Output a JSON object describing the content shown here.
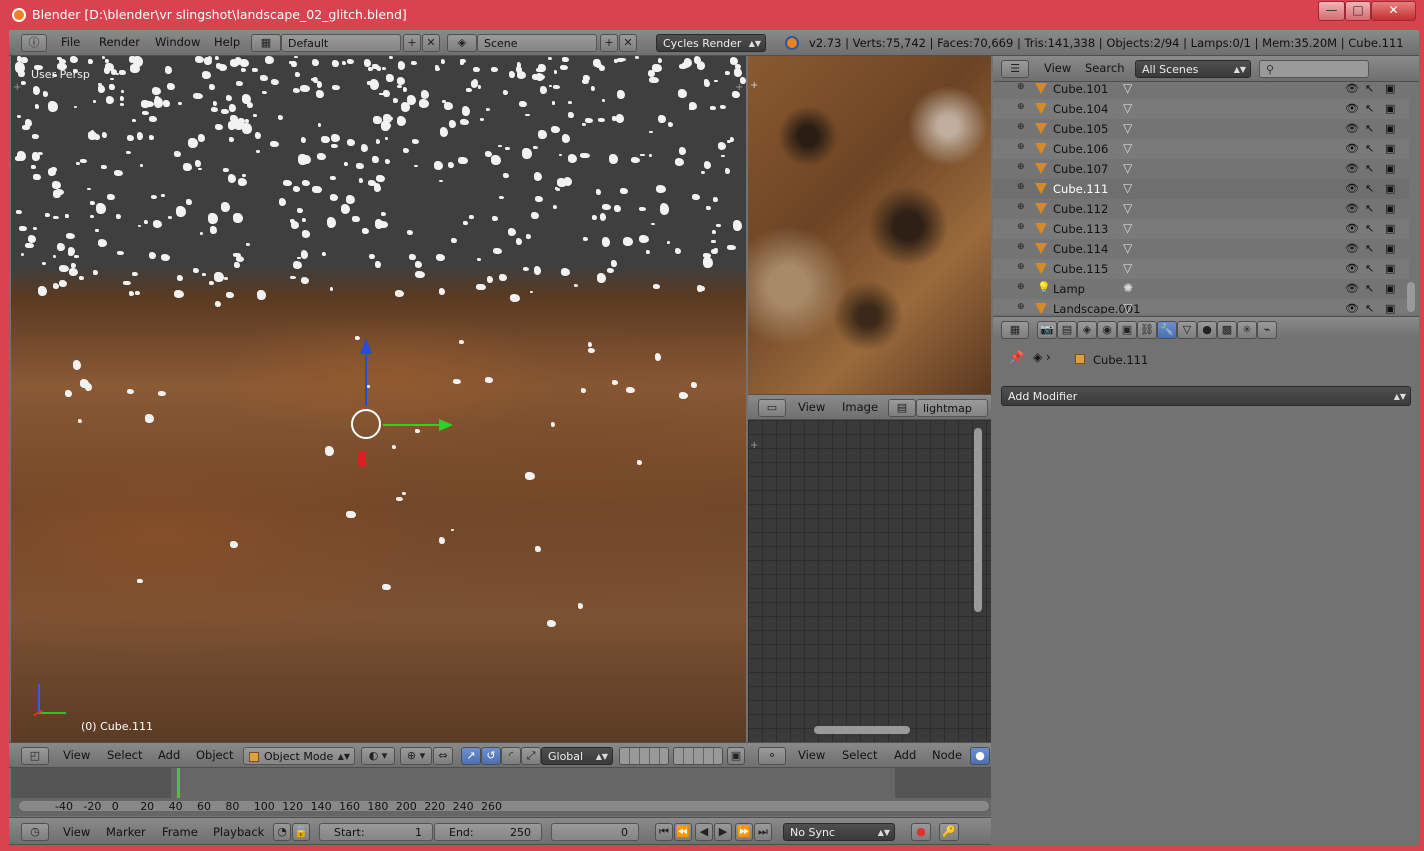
{
  "window": {
    "title": "Blender  [D:\\blender\\vr slingshot\\landscape_02_glitch.blend]",
    "minimize": "—",
    "maximize": "□",
    "close": "✕"
  },
  "topbar": {
    "menus": [
      "File",
      "Render",
      "Window",
      "Help"
    ],
    "layout": "Default",
    "scene": "Scene",
    "engine": "Cycles Render",
    "stats": "v2.73 | Verts:75,742 | Faces:70,669 | Tris:141,338 | Objects:2/94 | Lamps:0/1 | Mem:35.20M | Cube.111"
  },
  "viewport": {
    "view_label": "User Persp",
    "object_label": "(0) Cube.111",
    "menus": [
      "View",
      "Select",
      "Add",
      "Object"
    ],
    "mode": "Object Mode",
    "orientation": "Global"
  },
  "image_editor": {
    "menus": [
      "View",
      "Image"
    ],
    "image_name": "lightmap"
  },
  "node_editor": {
    "menus": [
      "View",
      "Select",
      "Add",
      "Node"
    ]
  },
  "outliner": {
    "menus": [
      "View",
      "Search"
    ],
    "filter": "All Scenes",
    "items": [
      {
        "name": "Cube.101",
        "type": "mesh"
      },
      {
        "name": "Cube.104",
        "type": "mesh"
      },
      {
        "name": "Cube.105",
        "type": "mesh"
      },
      {
        "name": "Cube.106",
        "type": "mesh"
      },
      {
        "name": "Cube.107",
        "type": "mesh"
      },
      {
        "name": "Cube.111",
        "type": "mesh",
        "selected": true
      },
      {
        "name": "Cube.112",
        "type": "mesh"
      },
      {
        "name": "Cube.113",
        "type": "mesh"
      },
      {
        "name": "Cube.114",
        "type": "mesh"
      },
      {
        "name": "Cube.115",
        "type": "mesh"
      },
      {
        "name": "Lamp",
        "type": "lamp"
      },
      {
        "name": "Landscape.001",
        "type": "mesh"
      }
    ]
  },
  "properties": {
    "object_name": "Cube.111",
    "add_modifier": "Add Modifier"
  },
  "timeline": {
    "ticks": [
      "-40",
      "-20",
      "0",
      "20",
      "40",
      "60",
      "80",
      "100",
      "120",
      "140",
      "160",
      "180",
      "200",
      "220",
      "240",
      "260"
    ],
    "menus": [
      "View",
      "Marker",
      "Frame",
      "Playback"
    ],
    "start_label": "Start:",
    "start_value": "1",
    "end_label": "End:",
    "end_value": "250",
    "current_frame": "0",
    "sync": "No Sync"
  },
  "colors": {
    "window_frame": "#d9434f",
    "panel_bg": "#727272",
    "selection_blue": "#5680c2",
    "playhead": "#3ec93e"
  }
}
